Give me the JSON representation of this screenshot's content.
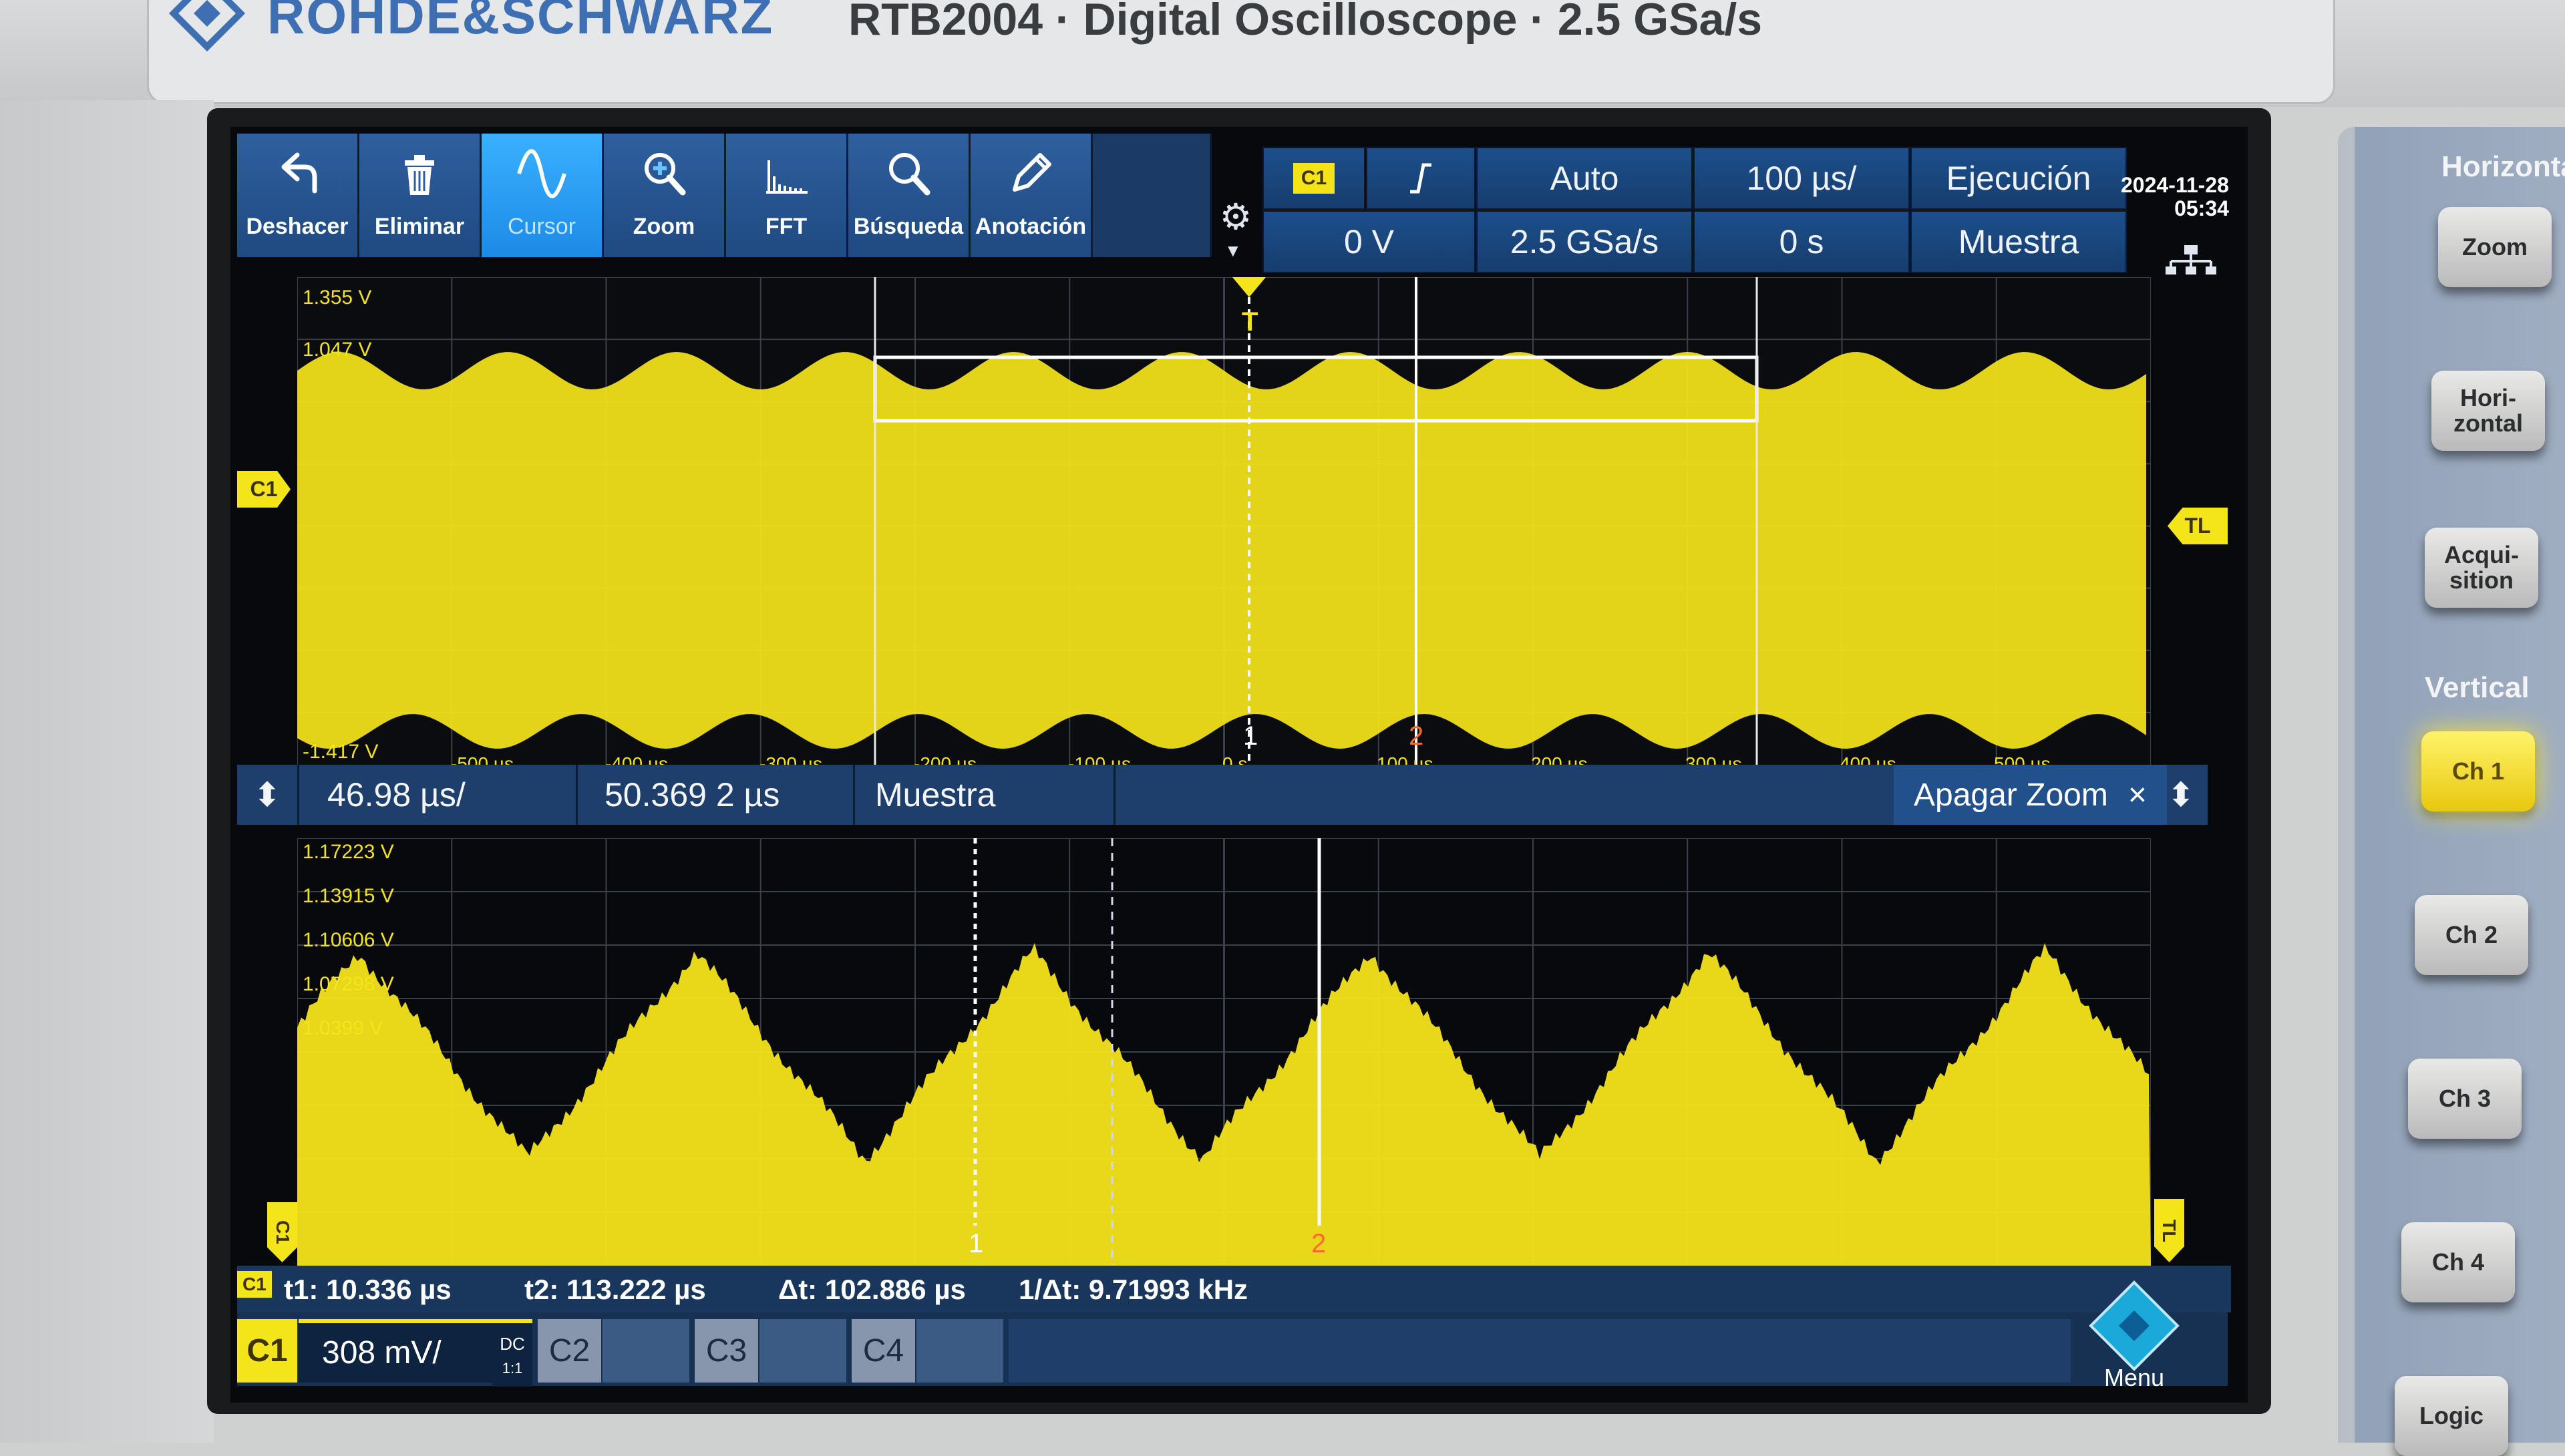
{
  "device": {
    "brand": "ROHDE&SCHWARZ",
    "title": "RTB2004 · Digital Oscilloscope · 2.5 GSa/s"
  },
  "toolbar": [
    {
      "label": "Deshacer",
      "icon": "undo-icon"
    },
    {
      "label": "Eliminar",
      "icon": "trash-icon"
    },
    {
      "label": "Cursor",
      "icon": "cursor-wave-icon",
      "active": true
    },
    {
      "label": "Zoom",
      "icon": "zoom-in-icon"
    },
    {
      "label": "FFT",
      "icon": "fft-icon"
    },
    {
      "label": "Búsqueda",
      "icon": "search-icon"
    },
    {
      "label": "Anotación",
      "icon": "pencil-icon"
    }
  ],
  "trigger": {
    "channel": "C1",
    "slope_icon": "rising-edge-icon",
    "mode": "Auto",
    "level": "0 V",
    "timebase": "100 µs/",
    "sample_rate": "2.5 GSa/s",
    "position": "0 s",
    "run_state": "Ejecución",
    "acquisition": "Muestra"
  },
  "datetime": {
    "date": "2024-11-28",
    "time": "05:34"
  },
  "overview": {
    "y_labels": [
      "1.355 V",
      "1.047 V",
      "-1.417 V"
    ],
    "x_labels": [
      "-500 µs",
      "-400 µs",
      "-300 µs",
      "-200 µs",
      "-100 µs",
      "0 s",
      "100 µs",
      "200 µs",
      "300 µs",
      "400 µs",
      "500 µs"
    ],
    "channel_marker": "C1",
    "trigger_level_marker": "TL",
    "cursor_1": "1",
    "cursor_2": "2",
    "trigger_marker": "T"
  },
  "zoom_bar": {
    "timebase": "46.98 µs/",
    "position": "50.369 2 µs",
    "acquisition": "Muestra",
    "zoom_off": "Apagar Zoom",
    "close": "×"
  },
  "zoom": {
    "y_labels": [
      "1.17223 V",
      "1.13915 V",
      "1.10606 V",
      "1.07298 V",
      "1.0399 V"
    ],
    "channel_marker": "C1",
    "trigger_level_marker": "TL",
    "cursor_1": "1",
    "cursor_2": "2"
  },
  "measurements": {
    "channel": "C1",
    "t1": "t1: 10.336 µs",
    "t2": "t2: 113.222 µs",
    "dt": "Δt: 102.886 µs",
    "inv_dt": "1/Δt: 9.71993 kHz"
  },
  "channels": {
    "c1": {
      "label": "C1",
      "scale": "308 mV/",
      "coupling": "DC",
      "ratio": "1:1"
    },
    "c2": "C2",
    "c3": "C3",
    "c4": "C4",
    "menu": "Menu"
  },
  "side_panel": {
    "horizontal_title": "Horizontal",
    "zoom": "Zoom",
    "horizontal": "Hori-\nzontal",
    "acquisition": "Acqui-\nsition",
    "vertical_title": "Vertical",
    "ch1": "Ch 1",
    "ch2": "Ch 2",
    "ch3": "Ch 3",
    "ch4": "Ch 4",
    "logic": "Logic"
  },
  "colors": {
    "trace": "#f4e41a",
    "toolbar_blue": "#1f4a82",
    "active_blue": "#2a9cf2",
    "background": "#07090c"
  }
}
